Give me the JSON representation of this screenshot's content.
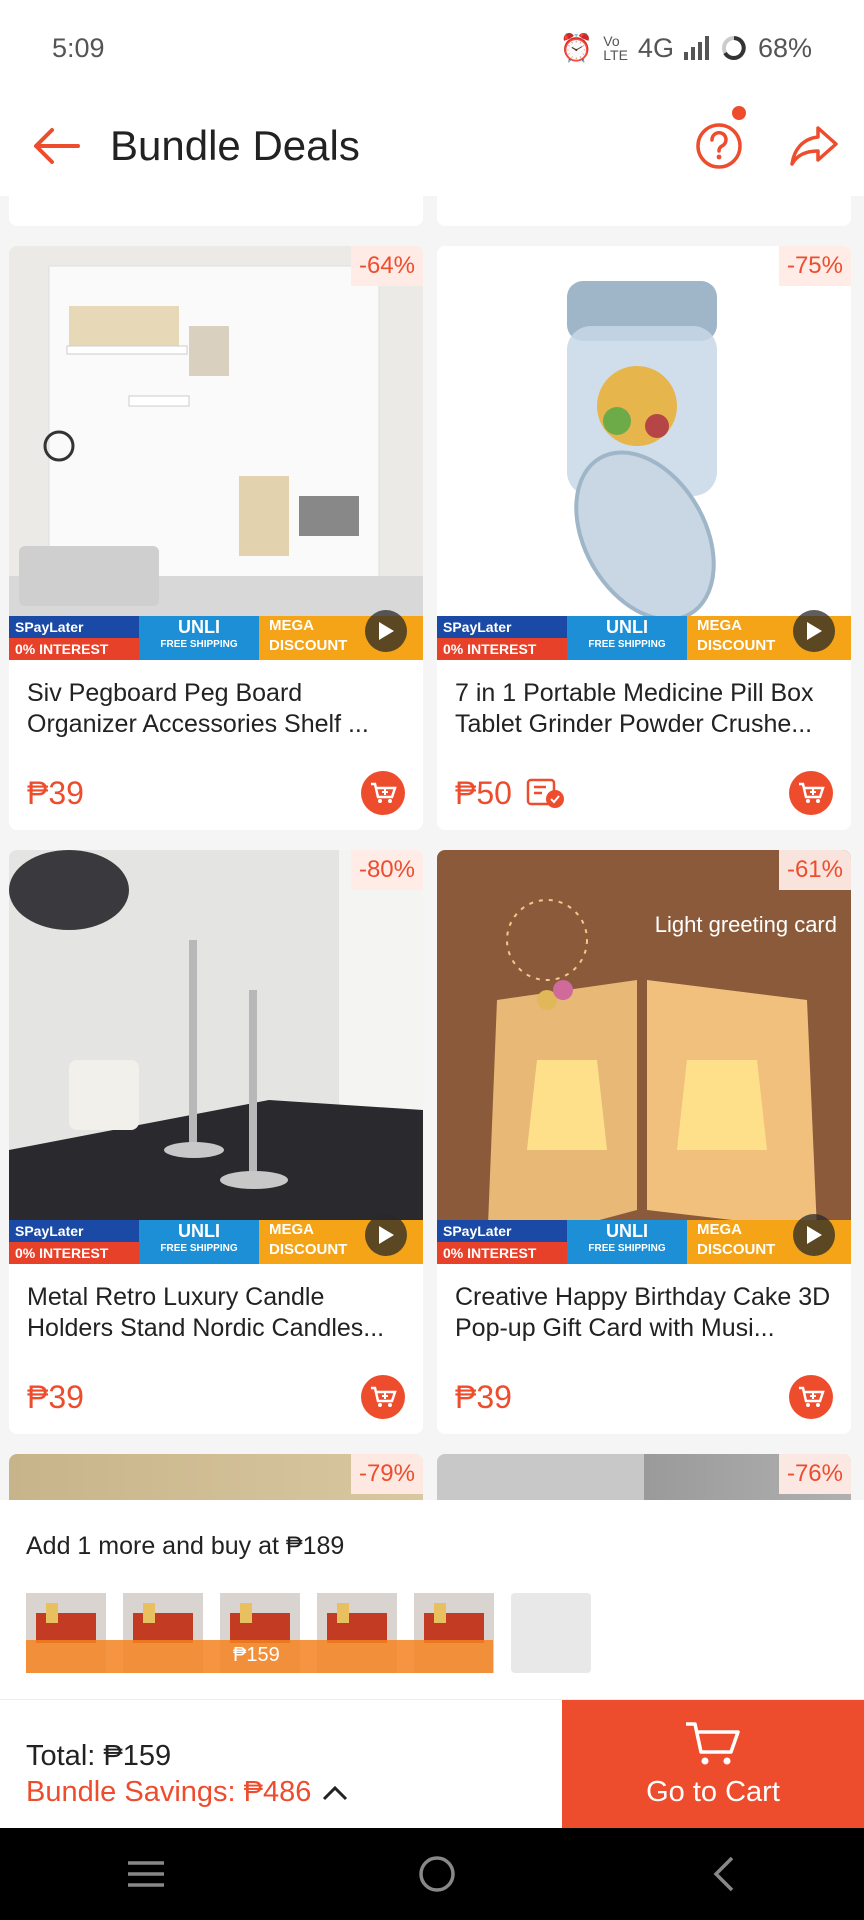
{
  "status": {
    "time": "5:09",
    "network": "4G",
    "battery": "68%"
  },
  "appbar": {
    "title": "Bundle Deals"
  },
  "products": [
    {
      "name": "Siv Pegboard Peg Board Organizer Accessories Shelf ...",
      "price": "₱39",
      "discount": "-64%"
    },
    {
      "name": "7 in 1 Portable Medicine Pill Box Tablet Grinder Powder Crushe...",
      "price": "₱50",
      "discount": "-75%"
    },
    {
      "name": "Metal Retro Luxury Candle Holders Stand Nordic Candles...",
      "price": "₱39",
      "discount": "-80%"
    },
    {
      "name": "Creative Happy Birthday Cake 3D Pop-up Gift Card with Musi...",
      "price": "₱39",
      "discount": "-61%",
      "image_caption": "Light greeting card"
    },
    {
      "discount": "-79%"
    },
    {
      "discount": "-76%"
    }
  ],
  "promo_banner": {
    "paylater": "SPayLater",
    "interest": "0% INTEREST",
    "unli": "UNLI",
    "free_shipping": "FREE SHIPPING",
    "mega": "MEGA",
    "discount": "DISCOUNT"
  },
  "bundle": {
    "message": "Add 1 more and buy at ₱189",
    "selected_price": "₱159"
  },
  "footer": {
    "total": "Total: ₱159",
    "savings": "Bundle Savings: ₱486",
    "go_to_cart": "Go to Cart"
  },
  "colors": {
    "accent": "#ee4d2d"
  }
}
